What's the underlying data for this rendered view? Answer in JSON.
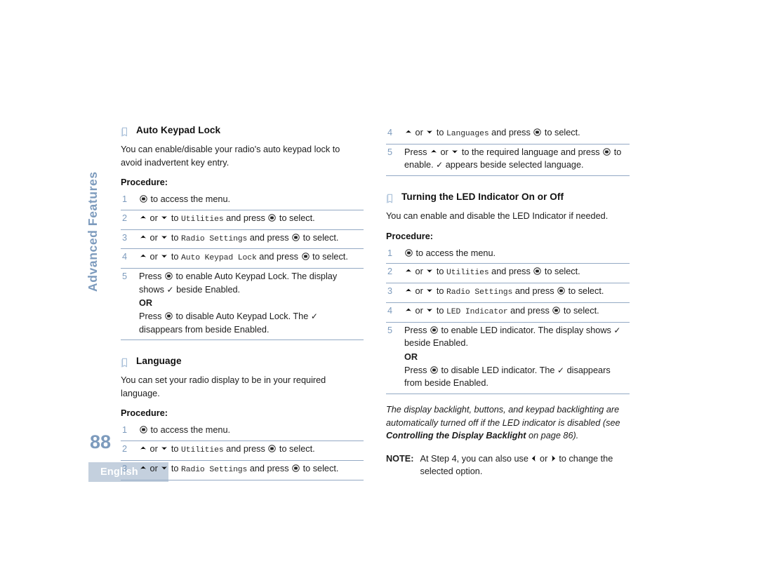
{
  "page": {
    "running_head": "Advanced Features",
    "folio": "88",
    "language_badge": "English"
  },
  "glyph_names": {
    "menu": "menu-button-icon",
    "up": "up-arrow-icon",
    "down": "down-arrow-icon",
    "left": "left-arrow-icon",
    "right": "right-arrow-icon",
    "check": "checkmark-icon",
    "bookmark": "section-bookmark-icon"
  },
  "colors": {
    "accent_blue_gray": "#7d9bbd",
    "rule_line": "#93a9c4",
    "badge_bg": "#c4d0de",
    "body_text": "#1d1d1d"
  },
  "left_column": {
    "sections": [
      {
        "title": "Auto Keypad Lock",
        "intro": "You can enable/disable your radio's auto keypad lock to avoid inadvertent key entry.",
        "procedure_label": "Procedure:",
        "steps": [
          {
            "num": "1",
            "parts": [
              {
                "t": "glyph",
                "g": "menu"
              },
              {
                "t": "text",
                "v": " to access the menu."
              }
            ]
          },
          {
            "num": "2",
            "parts": [
              {
                "t": "glyph",
                "g": "up"
              },
              {
                "t": "text",
                "v": " or "
              },
              {
                "t": "glyph",
                "g": "down"
              },
              {
                "t": "text",
                "v": " to "
              },
              {
                "t": "mono",
                "v": "Utilities"
              },
              {
                "t": "text",
                "v": " and press "
              },
              {
                "t": "glyph",
                "g": "menu"
              },
              {
                "t": "text",
                "v": " to select."
              }
            ]
          },
          {
            "num": "3",
            "parts": [
              {
                "t": "glyph",
                "g": "up"
              },
              {
                "t": "text",
                "v": " or "
              },
              {
                "t": "glyph",
                "g": "down"
              },
              {
                "t": "text",
                "v": " to "
              },
              {
                "t": "mono",
                "v": "Radio Settings"
              },
              {
                "t": "text",
                "v": " and press "
              },
              {
                "t": "glyph",
                "g": "menu"
              },
              {
                "t": "text",
                "v": " to select."
              }
            ]
          },
          {
            "num": "4",
            "parts": [
              {
                "t": "glyph",
                "g": "up"
              },
              {
                "t": "text",
                "v": " or "
              },
              {
                "t": "glyph",
                "g": "down"
              },
              {
                "t": "text",
                "v": " to "
              },
              {
                "t": "mono",
                "v": "Auto Keypad Lock"
              },
              {
                "t": "text",
                "v": " and press "
              },
              {
                "t": "glyph",
                "g": "menu"
              },
              {
                "t": "text",
                "v": " to select."
              }
            ]
          },
          {
            "num": "5",
            "parts": [
              {
                "t": "text",
                "v": "Press "
              },
              {
                "t": "glyph",
                "g": "menu"
              },
              {
                "t": "text",
                "v": " to enable Auto Keypad Lock. The display shows "
              },
              {
                "t": "glyph",
                "g": "check"
              },
              {
                "t": "text",
                "v": " beside Enabled."
              },
              {
                "t": "or",
                "v": "OR"
              },
              {
                "t": "text",
                "v": "Press "
              },
              {
                "t": "glyph",
                "g": "menu"
              },
              {
                "t": "text",
                "v": " to disable Auto Keypad Lock. The "
              },
              {
                "t": "glyph",
                "g": "check"
              },
              {
                "t": "text",
                "v": " disappears from beside Enabled."
              }
            ]
          }
        ]
      },
      {
        "title": "Language",
        "intro": "You can set your radio display to be in your required language.",
        "procedure_label": "Procedure:",
        "steps": [
          {
            "num": "1",
            "parts": [
              {
                "t": "glyph",
                "g": "menu"
              },
              {
                "t": "text",
                "v": " to access the menu."
              }
            ]
          },
          {
            "num": "2",
            "parts": [
              {
                "t": "glyph",
                "g": "up"
              },
              {
                "t": "text",
                "v": " or "
              },
              {
                "t": "glyph",
                "g": "down"
              },
              {
                "t": "text",
                "v": " to "
              },
              {
                "t": "mono",
                "v": "Utilities"
              },
              {
                "t": "text",
                "v": " and press "
              },
              {
                "t": "glyph",
                "g": "menu"
              },
              {
                "t": "text",
                "v": " to select."
              }
            ]
          },
          {
            "num": "3",
            "parts": [
              {
                "t": "glyph",
                "g": "up"
              },
              {
                "t": "text",
                "v": " or "
              },
              {
                "t": "glyph",
                "g": "down"
              },
              {
                "t": "text",
                "v": " to "
              },
              {
                "t": "mono",
                "v": "Radio Settings"
              },
              {
                "t": "text",
                "v": " and press "
              },
              {
                "t": "glyph",
                "g": "menu"
              },
              {
                "t": "text",
                "v": " to select."
              }
            ]
          }
        ]
      }
    ]
  },
  "right_column": {
    "continued_steps": [
      {
        "num": "4",
        "parts": [
          {
            "t": "glyph",
            "g": "up"
          },
          {
            "t": "text",
            "v": " or "
          },
          {
            "t": "glyph",
            "g": "down"
          },
          {
            "t": "text",
            "v": " to "
          },
          {
            "t": "mono",
            "v": "Languages"
          },
          {
            "t": "text",
            "v": " and press "
          },
          {
            "t": "glyph",
            "g": "menu"
          },
          {
            "t": "text",
            "v": " to select."
          }
        ]
      },
      {
        "num": "5",
        "parts": [
          {
            "t": "text",
            "v": "Press "
          },
          {
            "t": "glyph",
            "g": "up"
          },
          {
            "t": "text",
            "v": " or "
          },
          {
            "t": "glyph",
            "g": "down"
          },
          {
            "t": "text",
            "v": " to the required language and press "
          },
          {
            "t": "glyph",
            "g": "menu"
          },
          {
            "t": "text",
            "v": " to enable. "
          },
          {
            "t": "glyph",
            "g": "check"
          },
          {
            "t": "text",
            "v": " appears beside selected language."
          }
        ]
      }
    ],
    "sections": [
      {
        "title": "Turning the LED Indicator On or Off",
        "intro": "You can enable and disable the LED Indicator if needed.",
        "procedure_label": "Procedure:",
        "steps": [
          {
            "num": "1",
            "parts": [
              {
                "t": "glyph",
                "g": "menu"
              },
              {
                "t": "text",
                "v": " to access the menu."
              }
            ]
          },
          {
            "num": "2",
            "parts": [
              {
                "t": "glyph",
                "g": "up"
              },
              {
                "t": "text",
                "v": " or "
              },
              {
                "t": "glyph",
                "g": "down"
              },
              {
                "t": "text",
                "v": " to "
              },
              {
                "t": "mono",
                "v": "Utilities"
              },
              {
                "t": "text",
                "v": " and press "
              },
              {
                "t": "glyph",
                "g": "menu"
              },
              {
                "t": "text",
                "v": " to select."
              }
            ]
          },
          {
            "num": "3",
            "parts": [
              {
                "t": "glyph",
                "g": "up"
              },
              {
                "t": "text",
                "v": " or "
              },
              {
                "t": "glyph",
                "g": "down"
              },
              {
                "t": "text",
                "v": " to "
              },
              {
                "t": "mono",
                "v": "Radio Settings"
              },
              {
                "t": "text",
                "v": " and press "
              },
              {
                "t": "glyph",
                "g": "menu"
              },
              {
                "t": "text",
                "v": " to select."
              }
            ]
          },
          {
            "num": "4",
            "parts": [
              {
                "t": "glyph",
                "g": "up"
              },
              {
                "t": "text",
                "v": " or "
              },
              {
                "t": "glyph",
                "g": "down"
              },
              {
                "t": "text",
                "v": " to "
              },
              {
                "t": "mono",
                "v": "LED Indicator"
              },
              {
                "t": "text",
                "v": " and press "
              },
              {
                "t": "glyph",
                "g": "menu"
              },
              {
                "t": "text",
                "v": " to select."
              }
            ]
          },
          {
            "num": "5",
            "parts": [
              {
                "t": "text",
                "v": "Press "
              },
              {
                "t": "glyph",
                "g": "menu"
              },
              {
                "t": "text",
                "v": " to enable LED indicator. The display shows "
              },
              {
                "t": "glyph",
                "g": "check"
              },
              {
                "t": "text",
                "v": " beside Enabled."
              },
              {
                "t": "or",
                "v": "OR"
              },
              {
                "t": "text",
                "v": "Press "
              },
              {
                "t": "glyph",
                "g": "menu"
              },
              {
                "t": "text",
                "v": " to disable LED indicator. The "
              },
              {
                "t": "glyph",
                "g": "check"
              },
              {
                "t": "text",
                "v": " disappears from beside Enabled."
              }
            ]
          }
        ]
      }
    ],
    "italic_note": {
      "lead": "The display backlight, buttons, and keypad backlighting are automatically turned off if the LED indicator is disabled (see ",
      "bold_ref": "Controlling the Display Backlight",
      "tail": " on page 86)."
    },
    "note": {
      "key": "NOTE:",
      "before": "At Step 4, you can also use ",
      "mid": " or ",
      "after": " to change the selected option."
    }
  }
}
